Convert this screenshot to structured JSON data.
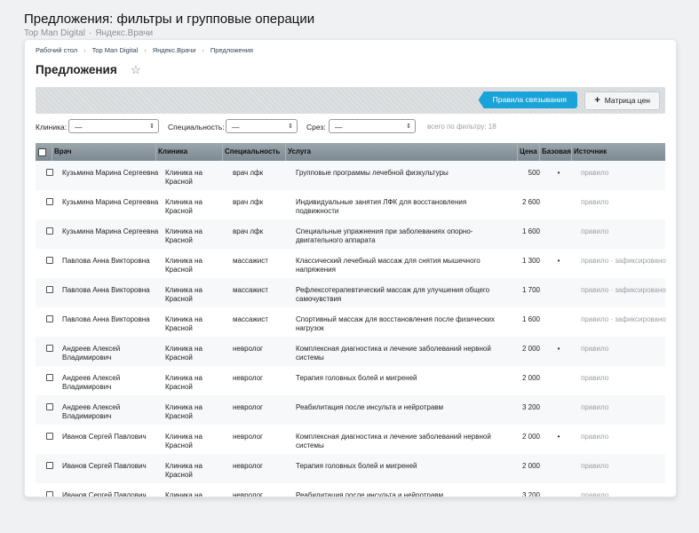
{
  "page": {
    "title": "Предложения: фильтры и групповые операции",
    "subtitle_left": "Top Man Digital",
    "subtitle_sep": "·",
    "subtitle_right": "Яндекс.Врачи"
  },
  "breadcrumbs": [
    "Рабочий стол",
    "Top Man Digital",
    "Яндекс.Врачи",
    "Предложения"
  ],
  "admin_title": "Предложения",
  "toolbar": {
    "rules_label": "Правила связывания",
    "matrix_label": "Матрица цен"
  },
  "filters": {
    "clinic_label": "Клиника:",
    "clinic_value": "—",
    "spec_label": "Специальность:",
    "spec_value": "—",
    "slice_label": "Срез:",
    "slice_value": "—",
    "count_text": "всего по фильтру: 18"
  },
  "columns": {
    "doctor": "Врач",
    "clinic": "Клиника",
    "specialty": "Специальность",
    "service": "Услуга",
    "price": "Цена",
    "base": "Базовая",
    "source": "Источник"
  },
  "rows": [
    {
      "doctor": "Кузьмина Марина Сергеевна",
      "clinic": "Клиника на Красной",
      "specialty": "врач лфк",
      "service": "Групповые программы лечебной физкультуры",
      "price": "500",
      "base": "•",
      "source": "правило"
    },
    {
      "doctor": "Кузьмина Марина Сергеевна",
      "clinic": "Клиника на Красной",
      "specialty": "врач лфк",
      "service": "Индивидуальные занятия ЛФК для восстановления подвижности",
      "price": "2 600",
      "base": "",
      "source": "правило"
    },
    {
      "doctor": "Кузьмина Марина Сергеевна",
      "clinic": "Клиника на Красной",
      "specialty": "врач лфк",
      "service": "Специальные упражнения при заболеваниях опорно-двигательного аппарата",
      "price": "1 600",
      "base": "",
      "source": "правило"
    },
    {
      "doctor": "Павлова Анна Викторовна",
      "clinic": "Клиника на Красной",
      "specialty": "массажист",
      "service": "Классический лечебный массаж для снятия мышечного напряжения",
      "price": "1 300",
      "base": "•",
      "source": "правило · зафиксировано"
    },
    {
      "doctor": "Павлова Анна Викторовна",
      "clinic": "Клиника на Красной",
      "specialty": "массажист",
      "service": "Рефлексотерапевтический массаж для улучшения общего самочувствия",
      "price": "1 700",
      "base": "",
      "source": "правило · зафиксировано"
    },
    {
      "doctor": "Павлова Анна Викторовна",
      "clinic": "Клиника на Красной",
      "specialty": "массажист",
      "service": "Спортивный массаж для восстановления после физических нагрузок",
      "price": "1 600",
      "base": "",
      "source": "правило · зафиксировано"
    },
    {
      "doctor": "Андреев Алексей Владимирович",
      "clinic": "Клиника на Красной",
      "specialty": "невролог",
      "service": "Комплексная диагностика и лечение заболеваний нервной системы",
      "price": "2 000",
      "base": "•",
      "source": "правило"
    },
    {
      "doctor": "Андреев Алексей Владимирович",
      "clinic": "Клиника на Красной",
      "specialty": "невролог",
      "service": "Терапия головных болей и мигреней",
      "price": "2 000",
      "base": "",
      "source": "правило"
    },
    {
      "doctor": "Андреев Алексей Владимирович",
      "clinic": "Клиника на Красной",
      "specialty": "невролог",
      "service": "Реабилитация после инсульта и нейротравм",
      "price": "3 200",
      "base": "",
      "source": "правило"
    },
    {
      "doctor": "Иванов Сергей Павлович",
      "clinic": "Клиника на Красной",
      "specialty": "невролог",
      "service": "Комплексная диагностика и лечение заболеваний нервной системы",
      "price": "2 000",
      "base": "•",
      "source": "правило"
    },
    {
      "doctor": "Иванов Сергей Павлович",
      "clinic": "Клиника на Красной",
      "specialty": "невролог",
      "service": "Терапия головных болей и мигреней",
      "price": "2 000",
      "base": "",
      "source": "правило"
    },
    {
      "doctor": "Иванов Сергей Павлович",
      "clinic": "Клиника на Красной",
      "specialty": "невролог",
      "service": "Реабилитация после инсульта и нейротравм",
      "price": "3 200",
      "base": "",
      "source": "правило"
    }
  ]
}
